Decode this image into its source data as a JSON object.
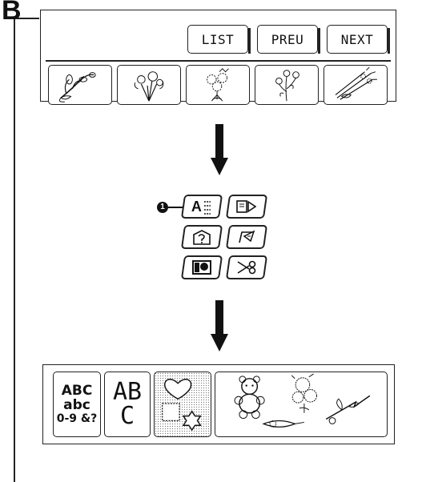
{
  "section": {
    "label": "B"
  },
  "top_panel": {
    "nav": {
      "list": "LIST",
      "prev": "PREU",
      "next": "NEXT"
    },
    "patterns": [
      {
        "name": "flower-pattern-1-icon"
      },
      {
        "name": "flower-pattern-2-icon"
      },
      {
        "name": "flower-pattern-3-icon"
      },
      {
        "name": "flower-pattern-4-icon"
      },
      {
        "name": "flower-pattern-5-icon"
      }
    ]
  },
  "keypad": {
    "callout": "1",
    "keys": [
      {
        "name": "character-key",
        "label": "A"
      },
      {
        "name": "frame-key",
        "icon": "frame-pattern-icon"
      },
      {
        "name": "memory-key",
        "icon": "memory-icon"
      },
      {
        "name": "edit-key",
        "icon": "edit-icon"
      },
      {
        "name": "card-key",
        "icon": "card-icon"
      },
      {
        "name": "cut-key",
        "icon": "scissors-icon"
      }
    ]
  },
  "bottom_panel": {
    "alphabet_small": {
      "line1": "ABC",
      "line2": "abc",
      "line3": "0-9 &?"
    },
    "alphabet_large": {
      "line1": "AB",
      "line2": "C"
    },
    "shapes_icon": "frame-shapes-icon",
    "motifs_icon": "embroidery-motifs-icon"
  },
  "colors": {
    "ink": "#111111",
    "background": "#ffffff"
  }
}
